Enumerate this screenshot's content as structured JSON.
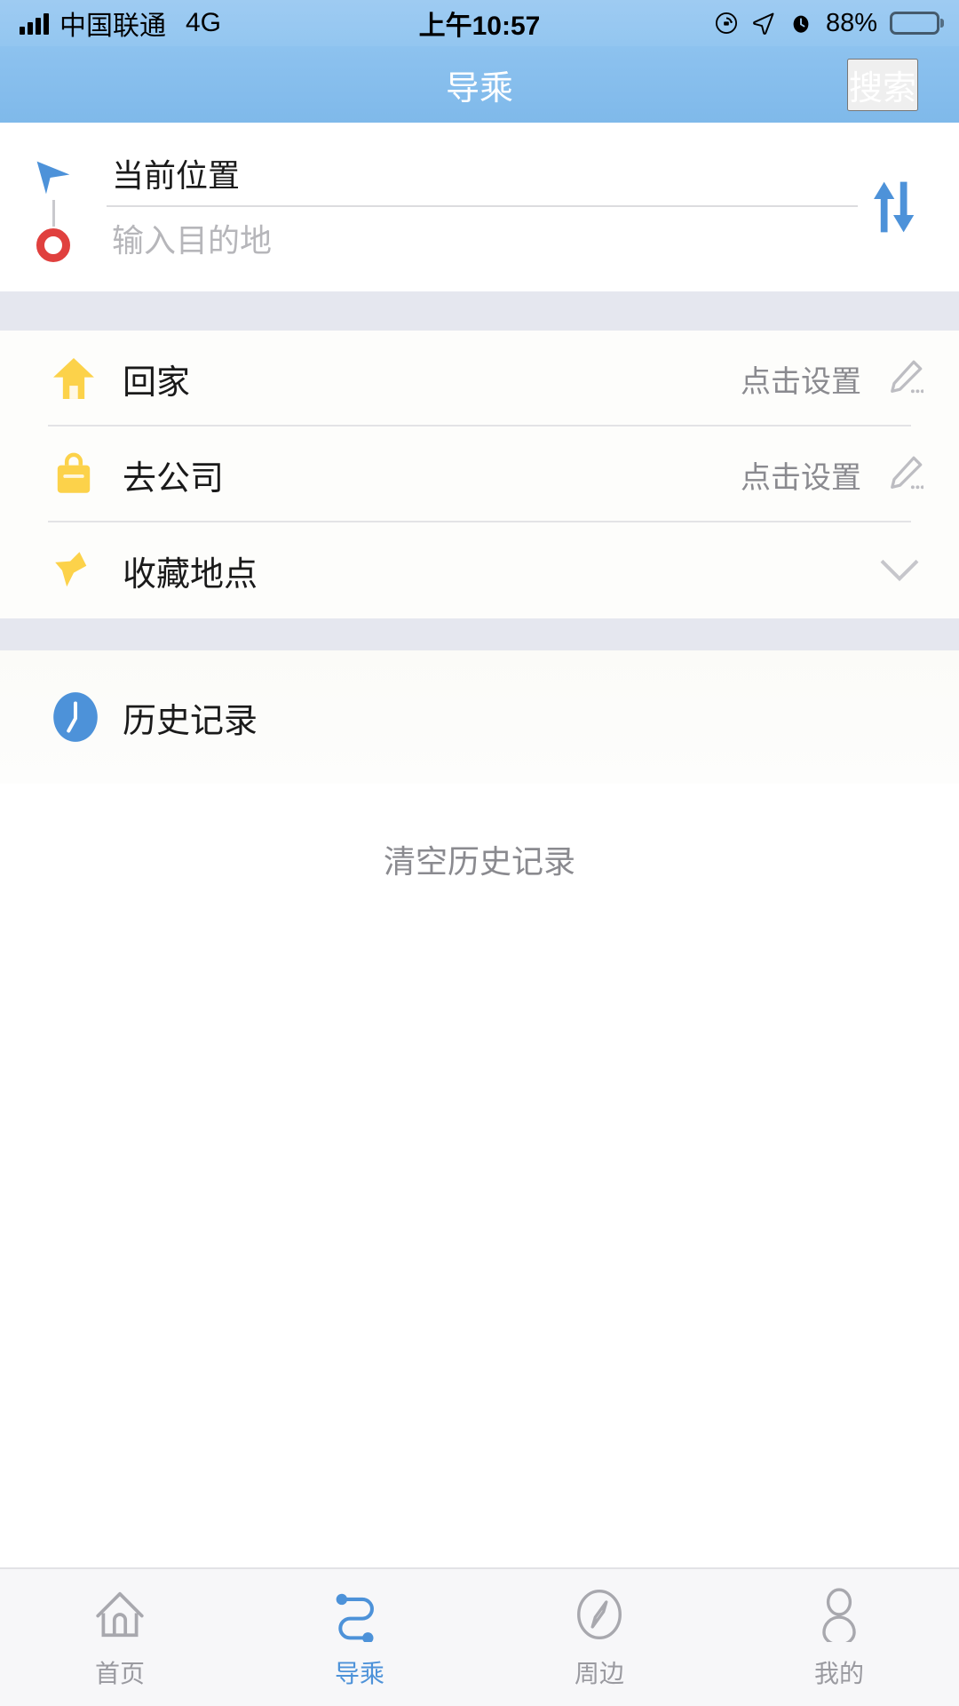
{
  "status_bar": {
    "carrier": "中国联通",
    "network": "4G",
    "time": "上午10:57",
    "battery_percent": "88%",
    "icons": [
      "signal-bars-icon",
      "rotation-lock-icon",
      "location-arrow-icon",
      "alarm-clock-icon",
      "battery-icon"
    ]
  },
  "nav_bar": {
    "title": "导乘",
    "action_label": "搜索"
  },
  "route": {
    "from_value": "当前位置",
    "from_placeholder": "当前位置",
    "to_value": "",
    "to_placeholder": "输入目的地",
    "swap_icon": "swap-vertical-icon",
    "start_marker_icon": "navigation-arrow-icon",
    "end_marker_icon": "destination-circle-icon"
  },
  "shortcuts": [
    {
      "icon": "home-icon",
      "label": "回家",
      "hint": "点击设置",
      "action_icon": "pencil-icon"
    },
    {
      "icon": "briefcase-icon",
      "label": "去公司",
      "hint": "点击设置",
      "action_icon": "pencil-icon"
    },
    {
      "icon": "pin-star-icon",
      "label": "收藏地点",
      "hint": "",
      "action_icon": "chevron-down-icon"
    }
  ],
  "history": {
    "icon": "clock-icon",
    "label": "历史记录",
    "clear_label": "清空历史记录"
  },
  "tabbar": {
    "items": [
      {
        "icon": "home-outline-icon",
        "label": "首页",
        "active": false
      },
      {
        "icon": "route-icon",
        "label": "导乘",
        "active": true
      },
      {
        "icon": "compass-outline-icon",
        "label": "周边",
        "active": false
      },
      {
        "icon": "person-outline-icon",
        "label": "我的",
        "active": false
      }
    ]
  },
  "colors": {
    "header_blue": "#8dc2ef",
    "accent_blue": "#4d92d9",
    "marker_red": "#e0403e",
    "shortcut_yellow": "#fcd24a",
    "section_gap": "#e5e7ef",
    "muted_text": "#8a8a8f"
  }
}
